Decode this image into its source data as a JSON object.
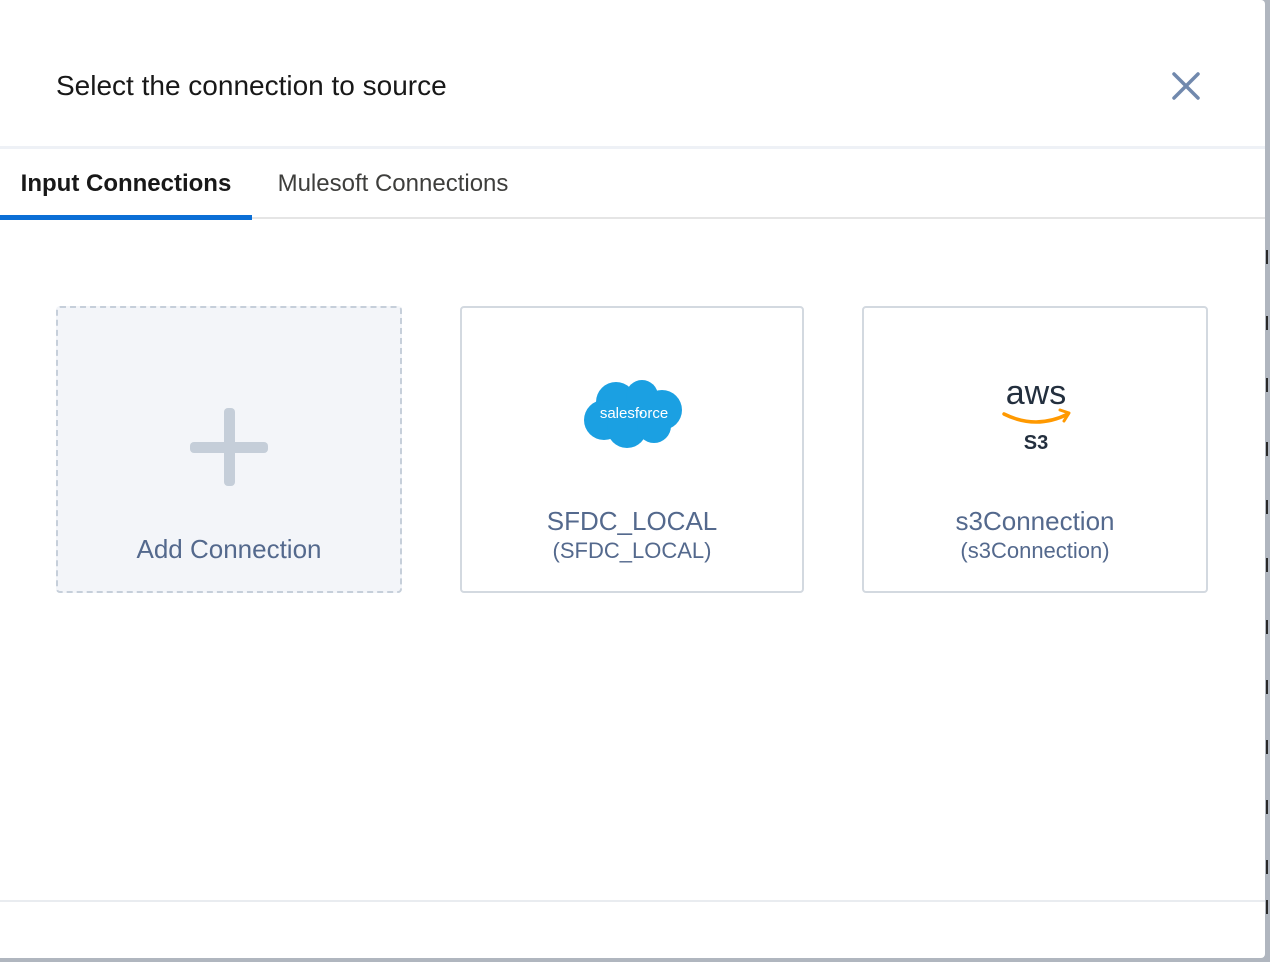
{
  "header": {
    "title": "Select the connection to source"
  },
  "tabs": [
    {
      "label": "Input Connections",
      "active": true
    },
    {
      "label": "Mulesoft Connections",
      "active": false
    }
  ],
  "cards": {
    "add": {
      "label": "Add Connection"
    },
    "connections": [
      {
        "name": "SFDC_LOCAL",
        "sub": "(SFDC_LOCAL)",
        "logo_text": "salesforce",
        "icon": "salesforce-logo"
      },
      {
        "name": "s3Connection",
        "sub": "(s3Connection)",
        "logo_text": "aws",
        "logo_sub": "S3",
        "icon": "aws-s3-logo"
      }
    ]
  },
  "colors": {
    "accent": "#0b6fd6",
    "salesforce_blue": "#1ba0e2",
    "aws_orange": "#ff9900",
    "label_slate": "#54698d"
  }
}
